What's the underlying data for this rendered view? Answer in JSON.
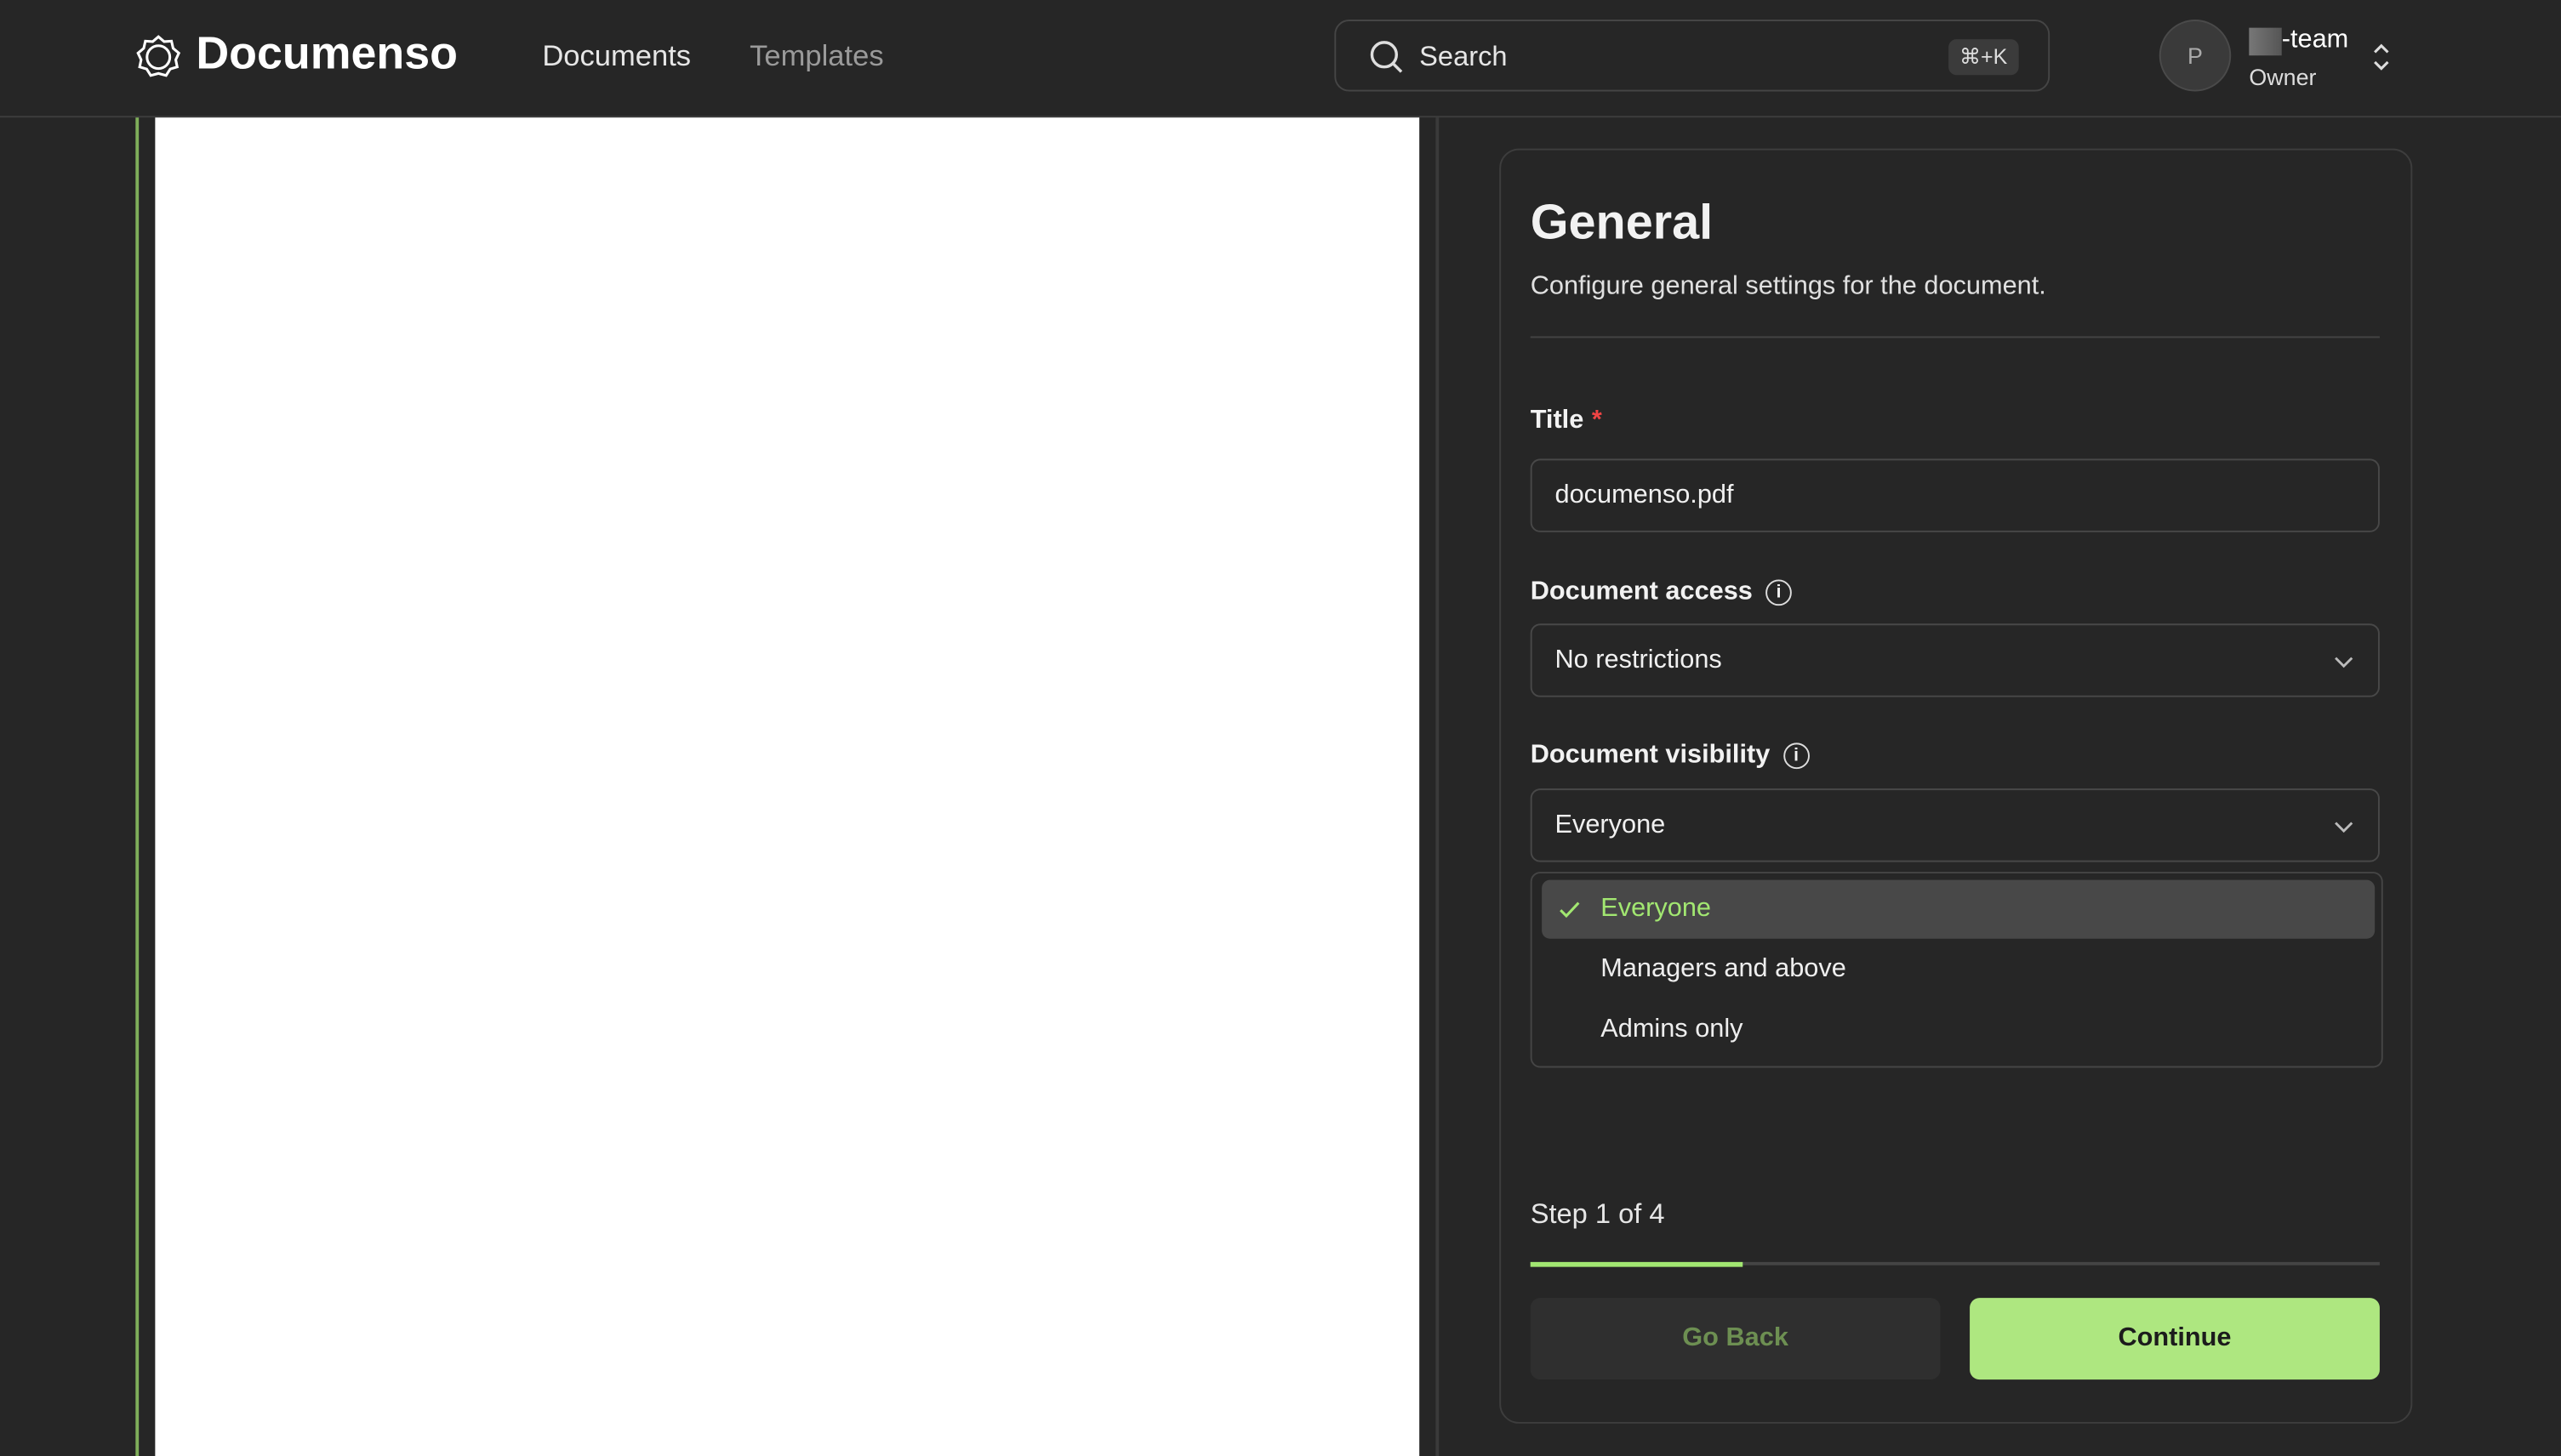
{
  "header": {
    "brand": "Documenso",
    "nav": [
      {
        "label": "Documents",
        "active": true
      },
      {
        "label": "Templates",
        "active": false
      }
    ],
    "search": {
      "placeholder": "Search",
      "shortcut": "⌘+K"
    },
    "account": {
      "avatar_initial": "P",
      "team_name": "-team",
      "role": "Owner"
    }
  },
  "panel": {
    "title": "General",
    "subtitle": "Configure general settings for the document.",
    "fields": {
      "title": {
        "label": "Title",
        "required_mark": "*",
        "value": "documenso.pdf"
      },
      "access": {
        "label": "Document access",
        "value": "No restrictions"
      },
      "visibility": {
        "label": "Document visibility",
        "value": "Everyone"
      }
    },
    "visibility_options": [
      {
        "label": "Everyone",
        "selected": true
      },
      {
        "label": "Managers and above",
        "selected": false
      },
      {
        "label": "Admins only",
        "selected": false
      }
    ],
    "step": {
      "text": "Step 1 of 4",
      "progress_percent": 25
    },
    "buttons": {
      "back": "Go Back",
      "continue": "Continue"
    }
  },
  "colors": {
    "accent": "#a2e771",
    "background": "#262626",
    "danger": "#ef4444"
  }
}
